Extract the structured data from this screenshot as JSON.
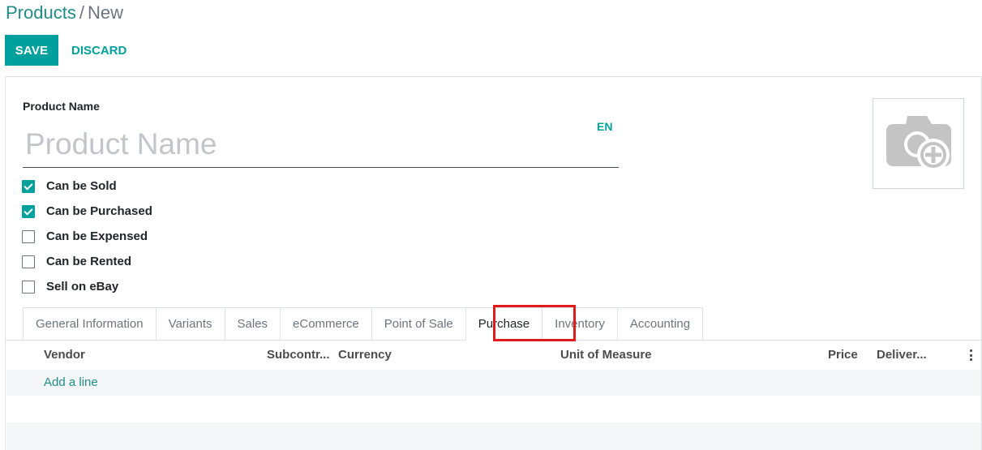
{
  "breadcrumb": {
    "parent": "Products",
    "separator": "/",
    "current": "New"
  },
  "toolbar": {
    "save_label": "SAVE",
    "discard_label": "DISCARD"
  },
  "form": {
    "name_label": "Product Name",
    "name_placeholder": "Product Name",
    "name_value": "",
    "lang_label": "EN",
    "photo_icon": "camera-plus-icon"
  },
  "checkboxes": [
    {
      "label": "Can be Sold",
      "checked": true
    },
    {
      "label": "Can be Purchased",
      "checked": true
    },
    {
      "label": "Can be Expensed",
      "checked": false
    },
    {
      "label": "Can be Rented",
      "checked": false
    },
    {
      "label": "Sell on eBay",
      "checked": false
    }
  ],
  "tabs": [
    {
      "label": "General Information"
    },
    {
      "label": "Variants"
    },
    {
      "label": "Sales"
    },
    {
      "label": "eCommerce"
    },
    {
      "label": "Point of Sale"
    },
    {
      "label": "Purchase",
      "active": true
    },
    {
      "label": "Inventory"
    },
    {
      "label": "Accounting"
    }
  ],
  "table": {
    "columns": [
      "Vendor",
      "Subcontr...",
      "Currency",
      "Unit of Measure",
      "Price",
      "Deliver..."
    ],
    "add_line": "Add a line",
    "options_icon": "kebab-menu-icon"
  },
  "colors": {
    "primary": "#00a09d",
    "link": "#1f8c86",
    "highlight": "#e01b1b"
  }
}
